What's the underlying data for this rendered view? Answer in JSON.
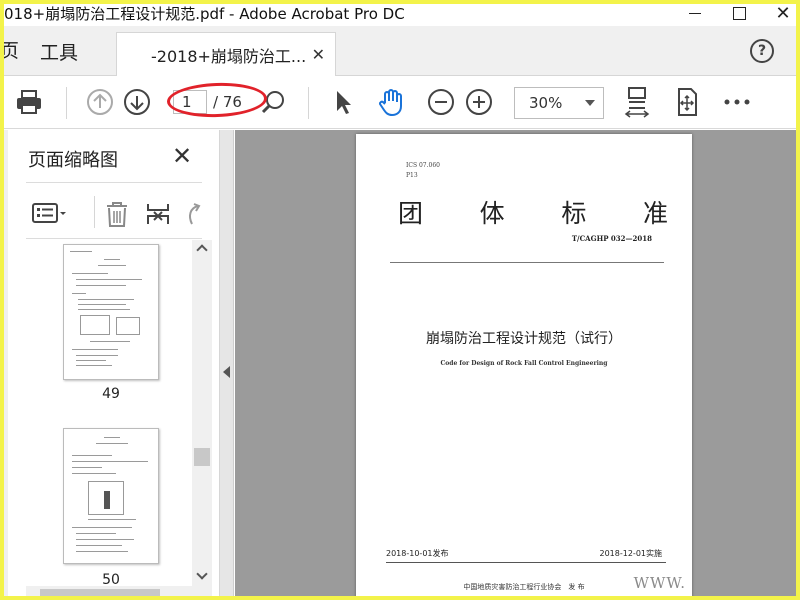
{
  "window": {
    "title": "018+崩塌防治工程设计规范.pdf - Adobe Acrobat Pro DC"
  },
  "tabs": {
    "home": "页",
    "tools": "工具",
    "document": "-2018+崩塌防治工..."
  },
  "toolbar": {
    "current_page": "1",
    "total_pages": "/ 76",
    "zoom": "30%"
  },
  "panel": {
    "title": "页面缩略图",
    "thumbnails": [
      {
        "label": "49"
      },
      {
        "label": "50"
      }
    ]
  },
  "page": {
    "ics": "ICS 07.060",
    "p13": "P13",
    "standard_chars": [
      "团",
      "体",
      "标",
      "准"
    ],
    "code": "T/CAGHP 032—2018",
    "title_cn": "崩塌防治工程设计规范（试行）",
    "title_en": "Code for Design of Rock Fall Control Engineering",
    "publish_date": "2018-10-01发布",
    "effective_date": "2018-12-01实施",
    "organization": "中国地质灾害防治工程行业协会　发 布",
    "watermark": "WWW."
  },
  "colors": {
    "highlight_ellipse": "#e1222a",
    "frame": "#f3f34a",
    "hand_tool": "#1a73d9"
  },
  "icons": [
    "print-icon",
    "page-up-icon",
    "page-down-icon",
    "zoom-marquee-icon",
    "select-arrow-icon",
    "hand-icon",
    "zoom-out-icon",
    "zoom-in-icon",
    "fit-page-icon",
    "fit-width-icon",
    "more-icon",
    "options-icon",
    "delete-icon",
    "extract-icon",
    "undo-icon",
    "close-icon",
    "help-icon"
  ]
}
